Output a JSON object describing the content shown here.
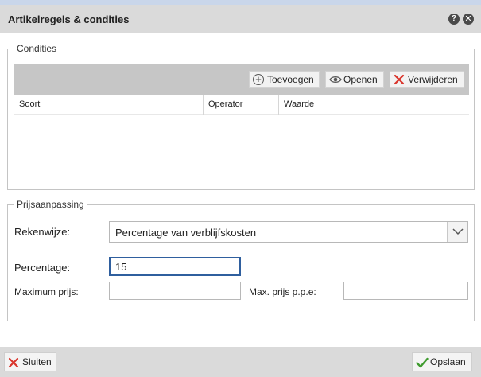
{
  "window": {
    "title": "Artikelregels & condities",
    "help_icon": "?",
    "close_icon": "✕"
  },
  "condities": {
    "legend": "Condities",
    "toolbar": {
      "add_label": "Toevoegen",
      "open_label": "Openen",
      "delete_label": "Verwijderen"
    },
    "columns": [
      "Soort",
      "Operator",
      "Waarde"
    ],
    "rows": []
  },
  "prijsaanpassing": {
    "legend": "Prijsaanpassing",
    "rekenwijze_label": "Rekenwijze:",
    "rekenwijze_value": "Percentage van verblijfskosten",
    "percentage_label": "Percentage:",
    "percentage_value": "15",
    "max_prijs_label": "Maximum prijs:",
    "max_prijs_value": "",
    "max_ppe_label": "Max. prijs p.p.e:",
    "max_ppe_value": ""
  },
  "footer": {
    "close_label": "Sluiten",
    "save_label": "Opslaan"
  },
  "colors": {
    "titlebar_bg": "#dadada",
    "toolbar_bg": "#c6c6c6",
    "delete_red": "#d9342b",
    "save_green": "#3f9b2f",
    "focus_border": "#2f5f9e"
  }
}
